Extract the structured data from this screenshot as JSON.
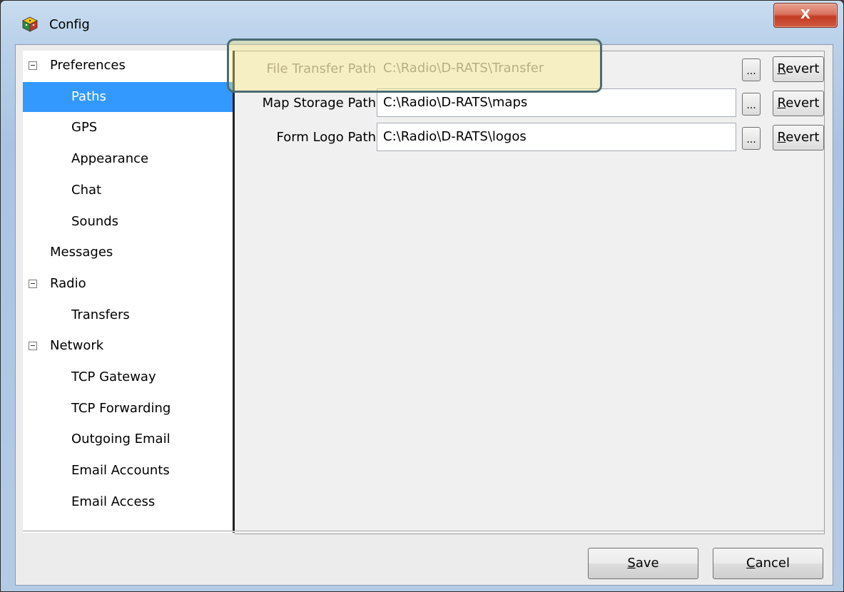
{
  "window": {
    "title": "Config",
    "close_glyph": "X"
  },
  "tree": {
    "items": [
      {
        "label": "Preferences",
        "expandable": true
      },
      {
        "label": "Paths",
        "selected": true
      },
      {
        "label": "GPS"
      },
      {
        "label": "Appearance"
      },
      {
        "label": "Chat"
      },
      {
        "label": "Sounds"
      },
      {
        "label": "Messages"
      },
      {
        "label": "Radio",
        "expandable": true
      },
      {
        "label": "Transfers"
      },
      {
        "label": "Network",
        "expandable": true
      },
      {
        "label": "TCP Gateway"
      },
      {
        "label": "TCP Forwarding"
      },
      {
        "label": "Outgoing Email"
      },
      {
        "label": "Email Accounts"
      },
      {
        "label": "Email Access"
      }
    ]
  },
  "paths": {
    "rows": [
      {
        "label": "File Transfer Path",
        "value": "C:\\Radio\\D-RATS\\Transfer",
        "browse": "...",
        "revert": "Revert",
        "disabled": true
      },
      {
        "label": "Map Storage Path",
        "value": "C:\\Radio\\D-RATS\\maps",
        "browse": "...",
        "revert": "Revert"
      },
      {
        "label": "Form Logo Path",
        "value": "C:\\Radio\\D-RATS\\logos",
        "browse": "...",
        "revert": "Revert"
      }
    ]
  },
  "footer": {
    "save_label": "Save",
    "cancel_label": "Cancel"
  },
  "colors": {
    "selection": "#3399ff",
    "close_button": "#c23b22",
    "highlight": "#ffec78"
  },
  "icons": {
    "app": "dice-cube-icon",
    "close": "close-icon",
    "tree_toggle": "collapse-minus-icon"
  }
}
